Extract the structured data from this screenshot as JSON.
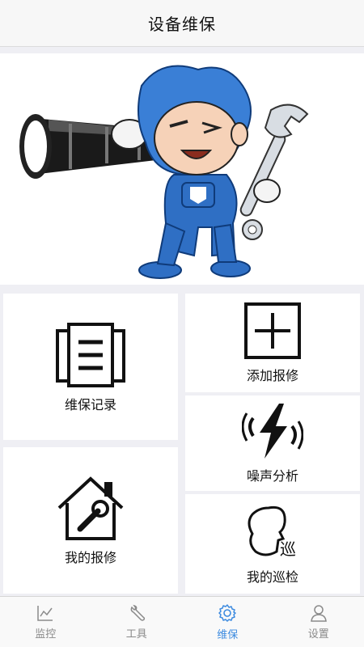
{
  "header": {
    "title": "设备维保"
  },
  "banner": {
    "icon": "mascot-with-telescope-and-wrench"
  },
  "tiles": {
    "records": {
      "label": "维保记录",
      "icon": "document-list-icon"
    },
    "add_repair": {
      "label": "添加报修",
      "icon": "plus-box-icon"
    },
    "noise_analysis": {
      "label": "噪声分析",
      "icon": "lightning-sound-icon"
    },
    "my_repairs": {
      "label": "我的报修",
      "icon": "house-wrench-icon"
    },
    "my_patrol": {
      "label": "我的巡检",
      "icon": "patrol-face-icon"
    }
  },
  "tabbar": {
    "items": [
      {
        "label": "监控",
        "icon": "chart-line-icon"
      },
      {
        "label": "工具",
        "icon": "wrench-icon"
      },
      {
        "label": "维保",
        "icon": "gear-icon"
      },
      {
        "label": "设置",
        "icon": "user-icon"
      }
    ],
    "active_index": 2,
    "active_color": "#3d8be0",
    "inactive_color": "#8a8a8a"
  }
}
